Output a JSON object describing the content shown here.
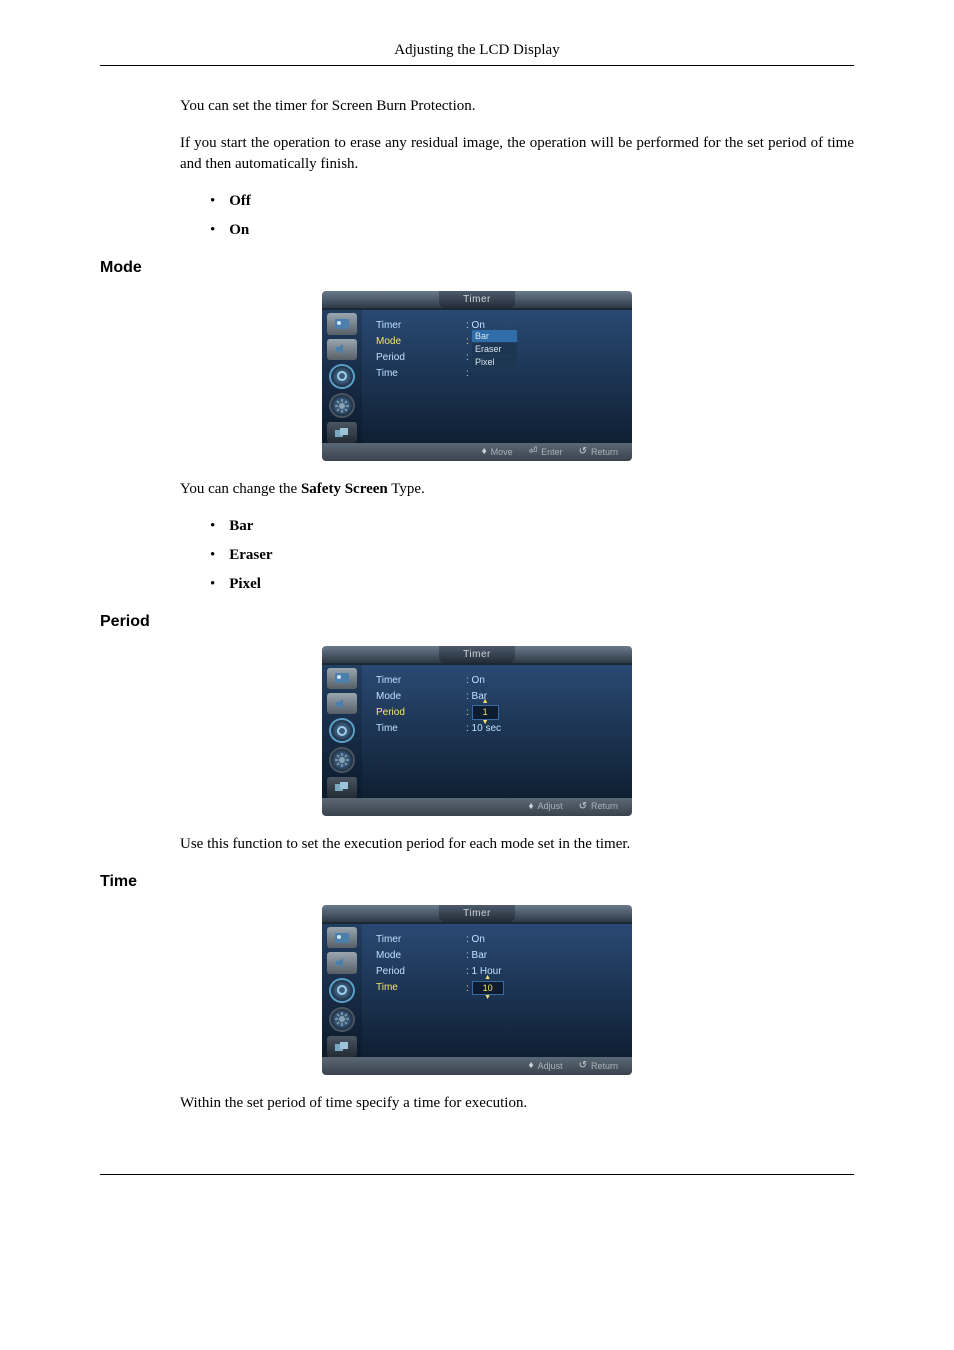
{
  "header": {
    "title": "Adjusting the LCD Display"
  },
  "intro": {
    "p1": "You can set the timer for Screen Burn Protection.",
    "p2": "If you start the operation to erase any residual image, the operation will be performed for the set period of time and then automatically finish.",
    "bullets": [
      "Off",
      "On"
    ]
  },
  "sections": {
    "mode": {
      "heading": "Mode",
      "body_prefix": "You can change the ",
      "body_bold": "Safety Screen",
      "body_suffix": " Type.",
      "bullets": [
        "Bar",
        "Eraser",
        "Pixel"
      ]
    },
    "period": {
      "heading": "Period",
      "body": "Use this function to set the execution period for each mode set in the timer."
    },
    "time": {
      "heading": "Time",
      "body": "Within the set period of time specify a time for execution."
    }
  },
  "osd_common": {
    "title": "Timer",
    "rows": {
      "timer_label": "Timer",
      "mode_label": "Mode",
      "period_label": "Period",
      "time_label": "Time"
    },
    "footer": {
      "move": "Move",
      "enter": "Enter",
      "adjust": "Adjust",
      "return": "Return"
    }
  },
  "osd_mode": {
    "timer_value": ": On",
    "mode_options": [
      "Bar",
      "Eraser",
      "Pixel"
    ],
    "selected_index": 0
  },
  "osd_period": {
    "timer_value": ": On",
    "mode_value": ": Bar",
    "period_spin": "1",
    "time_value": ": 10 sec"
  },
  "osd_time": {
    "timer_value": ": On",
    "mode_value": ": Bar",
    "period_value": ": 1 Hour",
    "time_spin": "10"
  }
}
